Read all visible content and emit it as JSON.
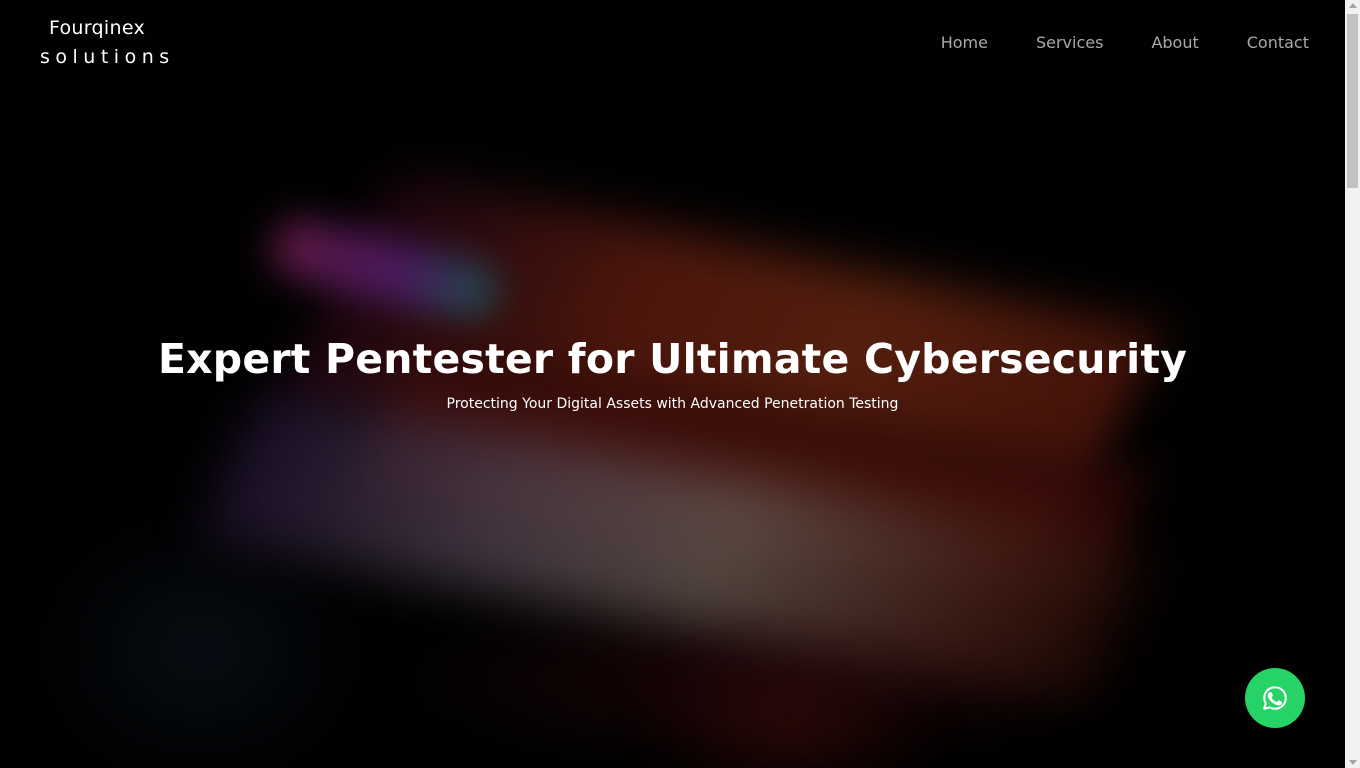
{
  "brand": {
    "name_line1": "Fourqinex",
    "name_line2": "solutions"
  },
  "nav": {
    "items": [
      {
        "label": "Home"
      },
      {
        "label": "Services"
      },
      {
        "label": "About"
      },
      {
        "label": "Contact"
      }
    ]
  },
  "hero": {
    "title": "Expert Pentester for Ultimate Cybersecurity",
    "subtitle": "Protecting Your Digital Assets with Advanced Penetration Testing",
    "background": "blurred laptop with red keyboard backlight"
  },
  "floating_action": {
    "icon": "whatsapp-icon",
    "color": "#25d366"
  },
  "colors": {
    "background": "#020202",
    "nav_text": "#a9a9a9",
    "hero_text": "#ffffff"
  }
}
